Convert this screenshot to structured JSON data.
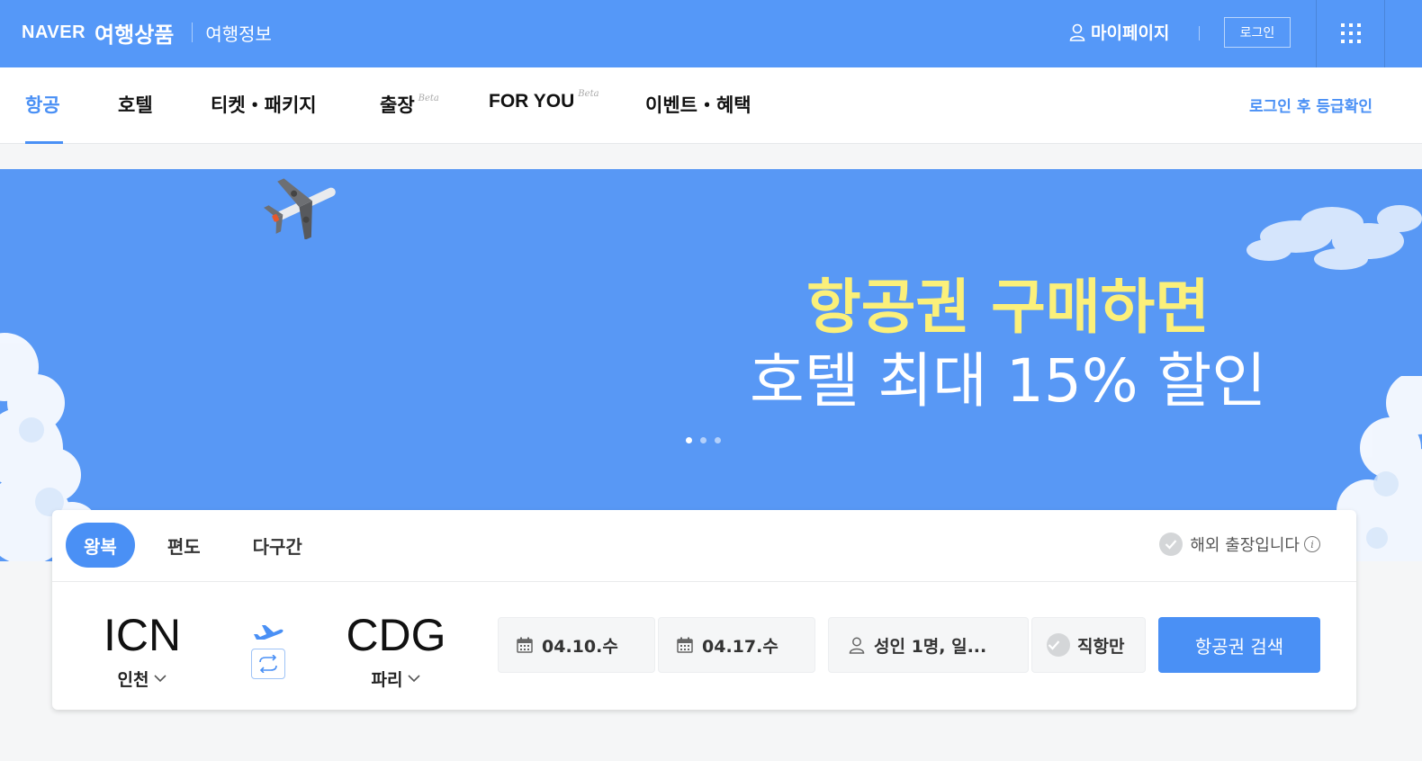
{
  "header": {
    "brand": "NAVER",
    "product": "여행상품",
    "info_link": "여행정보",
    "mypage_label": "마이페이지",
    "login_label": "로그인"
  },
  "nav": {
    "items": [
      {
        "label": "항공",
        "active": true
      },
      {
        "label": "호텔"
      },
      {
        "label": "티켓・패키지"
      },
      {
        "label": "출장",
        "badge": "Beta"
      },
      {
        "label": "FOR YOU",
        "badge": "Beta"
      },
      {
        "label": "이벤트・혜택"
      }
    ],
    "grade_link": "로그인 후 등급확인"
  },
  "banner": {
    "headline": "항공권 구매하면",
    "subline": "호텔 최대 15% 할인",
    "slide_count": 3,
    "current_slide": 1
  },
  "search": {
    "trip_types": [
      "왕복",
      "편도",
      "다구간"
    ],
    "selected_trip_type": "왕복",
    "business_trip_label": "해외 출장입니다",
    "origin": {
      "code": "ICN",
      "city": "인천"
    },
    "destination": {
      "code": "CDG",
      "city": "파리"
    },
    "depart_date": "04.10.수",
    "return_date": "04.17.수",
    "passengers": "성인 1명, 일...",
    "direct_only_label": "직항만",
    "search_button": "항공권 검색"
  },
  "colors": {
    "brand_blue": "#5598f8",
    "accent_blue": "#4a90f5",
    "banner_blue": "#5898f5",
    "headline_yellow": "#fbf07a"
  }
}
